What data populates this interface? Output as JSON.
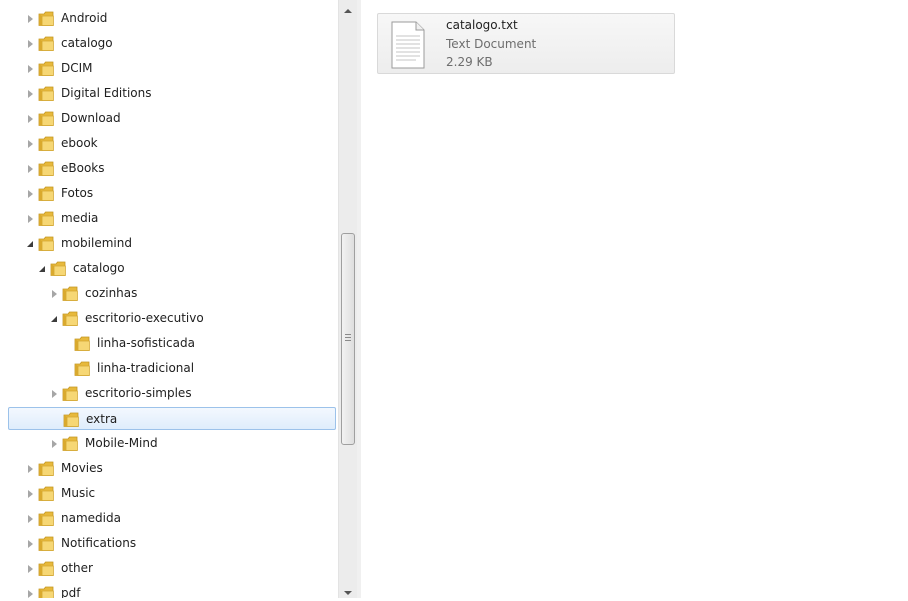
{
  "navigation_tree": [
    {
      "label": "Android",
      "level": 0,
      "state": "collapsed",
      "selected": false
    },
    {
      "label": "catalogo",
      "level": 0,
      "state": "collapsed",
      "selected": false
    },
    {
      "label": "DCIM",
      "level": 0,
      "state": "collapsed",
      "selected": false
    },
    {
      "label": "Digital Editions",
      "level": 0,
      "state": "collapsed",
      "selected": false
    },
    {
      "label": "Download",
      "level": 0,
      "state": "collapsed",
      "selected": false
    },
    {
      "label": "ebook",
      "level": 0,
      "state": "collapsed",
      "selected": false
    },
    {
      "label": "eBooks",
      "level": 0,
      "state": "collapsed",
      "selected": false
    },
    {
      "label": "Fotos",
      "level": 0,
      "state": "collapsed",
      "selected": false
    },
    {
      "label": "media",
      "level": 0,
      "state": "collapsed",
      "selected": false
    },
    {
      "label": "mobilemind",
      "level": 0,
      "state": "expanded",
      "selected": false
    },
    {
      "label": "catalogo",
      "level": 1,
      "state": "expanded",
      "selected": false
    },
    {
      "label": "cozinhas",
      "level": 2,
      "state": "collapsed",
      "selected": false
    },
    {
      "label": "escritorio-executivo",
      "level": 2,
      "state": "expanded",
      "selected": false
    },
    {
      "label": "linha-sofisticada",
      "level": 3,
      "state": "none",
      "selected": false
    },
    {
      "label": "linha-tradicional",
      "level": 3,
      "state": "none",
      "selected": false
    },
    {
      "label": "escritorio-simples",
      "level": 2,
      "state": "collapsed",
      "selected": false
    },
    {
      "label": "extra",
      "level": 2,
      "state": "none",
      "selected": true
    },
    {
      "label": "Mobile-Mind",
      "level": 2,
      "state": "collapsed",
      "selected": false
    },
    {
      "label": "Movies",
      "level": 0,
      "state": "collapsed",
      "selected": false
    },
    {
      "label": "Music",
      "level": 0,
      "state": "collapsed",
      "selected": false
    },
    {
      "label": "namedida",
      "level": 0,
      "state": "collapsed",
      "selected": false
    },
    {
      "label": "Notifications",
      "level": 0,
      "state": "collapsed",
      "selected": false
    },
    {
      "label": "other",
      "level": 0,
      "state": "collapsed",
      "selected": false
    },
    {
      "label": "pdf",
      "level": 0,
      "state": "collapsed",
      "selected": false
    }
  ],
  "file": {
    "name": "catalogo.txt",
    "type": "Text Document",
    "size": "2.29 KB"
  },
  "icons": {
    "folder": "folder-icon",
    "file": "text-document-icon",
    "expand": "expand-arrow-icon",
    "collapse": "collapse-arrow-icon"
  },
  "colors": {
    "selection_border": "#9cc2ea",
    "selection_fill": "#dfedfc",
    "folder_yellow": "#f3cc54",
    "secondary_text": "#6d6d6d"
  }
}
